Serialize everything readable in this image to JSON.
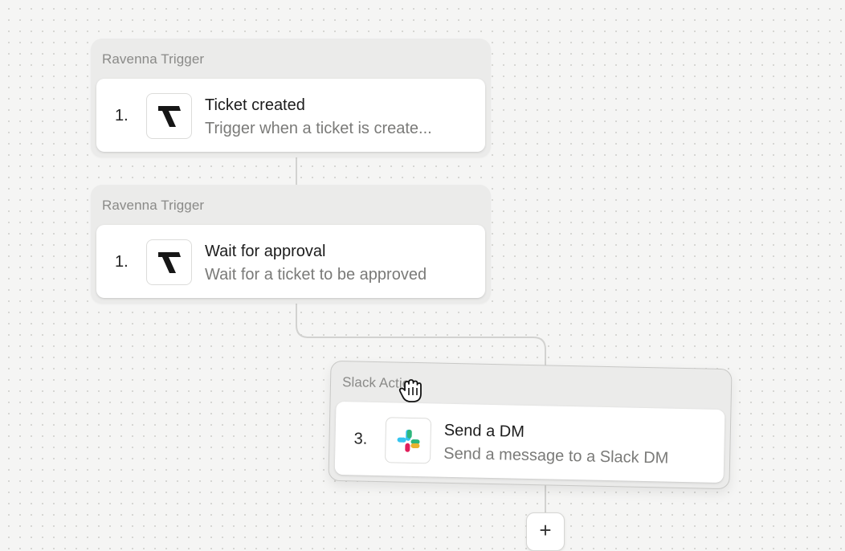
{
  "nodes": [
    {
      "header": "Ravenna Trigger",
      "step": "1.",
      "title": "Ticket created",
      "subtitle": "Trigger when a ticket is create...",
      "icon": "ravenna-logo-icon"
    },
    {
      "header": "Ravenna Trigger",
      "step": "1.",
      "title": "Wait for approval",
      "subtitle": "Wait for a ticket to be approved",
      "icon": "ravenna-logo-icon"
    },
    {
      "header": "Slack Action",
      "step": "3.",
      "title": "Send a DM",
      "subtitle": "Send a message to a Slack DM",
      "icon": "slack-logo-icon"
    }
  ],
  "add_button": {
    "label": "+"
  },
  "colors": {
    "canvas": "#f5f5f4",
    "node_bg": "#ebebea",
    "card_bg": "#ffffff",
    "connector": "#d2d2d0",
    "slack_blue": "#36C5F0",
    "slack_green": "#2EB67D",
    "slack_yellow": "#ECB22E",
    "slack_red": "#E01E5A"
  }
}
